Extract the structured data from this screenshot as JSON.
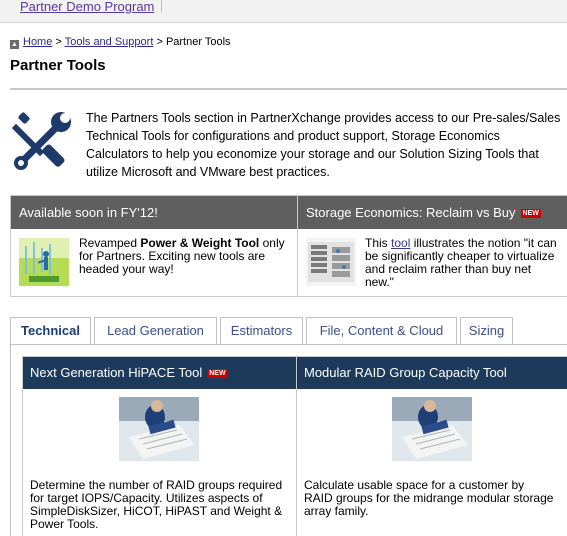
{
  "topbar": {
    "program_link": "Partner Demo Program"
  },
  "breadcrumb": {
    "home": "Home",
    "sep1": ">",
    "tools_support": "Tools and Support",
    "sep2": ">",
    "current": "Partner Tools"
  },
  "page": {
    "title": "Partner Tools"
  },
  "intro": {
    "text": "The Partners Tools section in PartnerXchange provides access to our Pre-sales/Sales Technical Tools for configurations and product support, Storage Economics Calculators to help you economize your storage and our Solution Sizing Tools that utilize Microsoft and VMware best practices."
  },
  "promos": [
    {
      "heading": "Available soon in FY'12!",
      "body_pre": "Revamped ",
      "body_bold": "Power & Weight Tool",
      "body_post": " only for Partners. Exciting new tools are headed your way!"
    },
    {
      "heading": "Storage Economics: Reclaim vs Buy",
      "badge": "NEW",
      "body_pre": "This ",
      "body_link": "tool",
      "body_post": " illustrates the notion \"it can be significantly cheaper to virtualize and reclaim rather than buy net new.\""
    }
  ],
  "tabs": [
    {
      "label": "Technical",
      "active": true
    },
    {
      "label": "Lead Generation",
      "active": false
    },
    {
      "label": "Estimators",
      "active": false
    },
    {
      "label": "File, Content & Cloud",
      "active": false
    },
    {
      "label": "Sizing",
      "active": false
    }
  ],
  "tools": [
    {
      "title": "Next Generation HiPACE Tool",
      "badge": "NEW",
      "description": "Determine the number of RAID groups required for target IOPS/Capacity. Utilizes aspects of SimpleDiskSizer, HiCOT, HiPAST and Weight & Power Tools."
    },
    {
      "title": "Modular RAID Group Capacity Tool",
      "description": "Calculate usable space for a customer by RAID groups for the midrange modular storage array family."
    }
  ],
  "colors": {
    "promo_header": "#5f5f5f",
    "tool_header": "#1e3a5a",
    "new_badge": "#cc0000",
    "link": "#2a2a8a"
  },
  "icons": [
    "up-arrow-icon",
    "tools-wrench-screwdriver-icon",
    "new-badge-icon"
  ]
}
